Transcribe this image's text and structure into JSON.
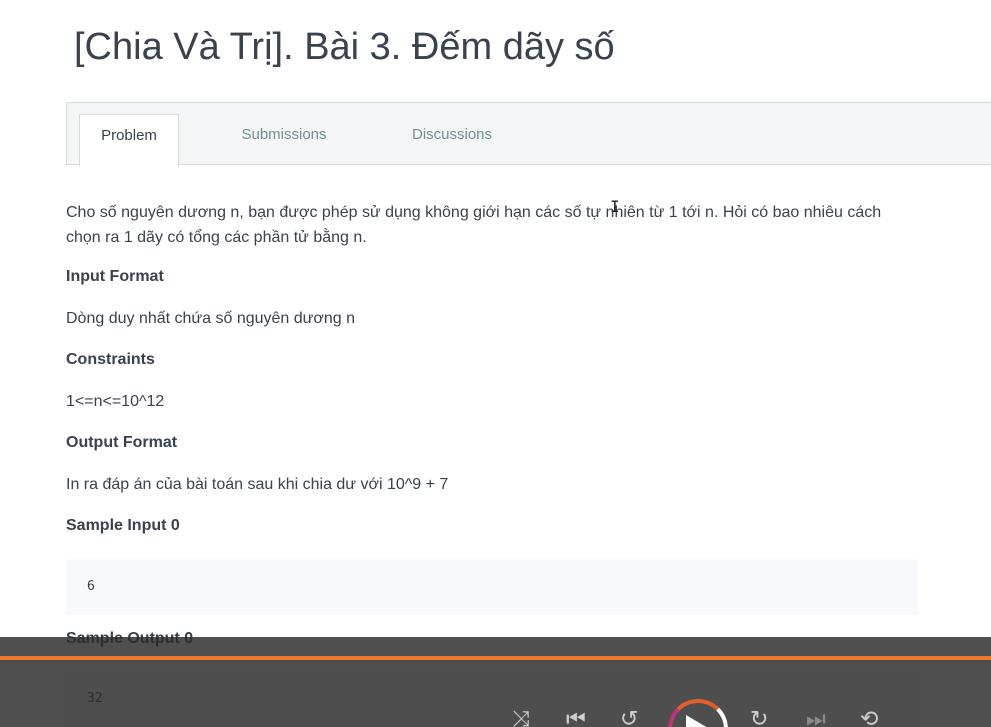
{
  "page": {
    "title": "[Chia Và Trị]. Bài 3. Đếm dãy số"
  },
  "tabs": [
    {
      "label": "Problem",
      "active": true
    },
    {
      "label": "Submissions",
      "active": false
    },
    {
      "label": "Discussions",
      "active": false
    }
  ],
  "problem": {
    "description": "Cho số nguyên dương n, bạn được phép sử dụng không giới hạn các số tự nhiên từ 1 tới n. Hỏi có bao nhiêu cách chọn ra 1 dãy có tổng các phần tử bằng n.",
    "input_format_heading": "Input Format",
    "input_format": "Dòng duy nhất chứa số nguyên dương n",
    "constraints_heading": "Constraints",
    "constraints": "1<=n<=10^12",
    "output_format_heading": "Output Format",
    "output_format": "In ra đáp án của bài toán sau khi chia dư với 10^9 + 7",
    "sample_input_heading": "Sample Input 0",
    "sample_input": "6",
    "sample_output_heading": "Sample Output 0",
    "sample_output": "32"
  },
  "player": {
    "accent_color": "#f07a2a",
    "icons": [
      "shuffle-icon",
      "previous-icon",
      "rewind-icon",
      "play-icon",
      "forward-icon",
      "next-icon",
      "repeat-icon"
    ]
  }
}
